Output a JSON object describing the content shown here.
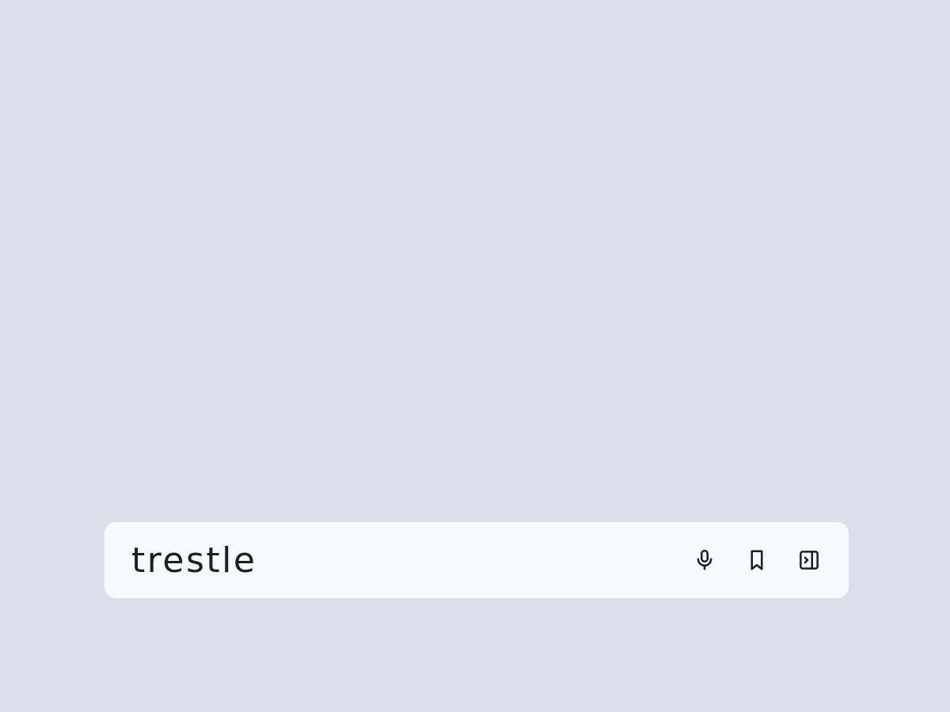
{
  "search": {
    "query": "trestle"
  },
  "toolbar": {
    "icons": [
      "microphone-icon",
      "bookmark-icon",
      "sidebar-panel-icon"
    ]
  },
  "colors": {
    "background": "#dcdfe7",
    "bar": "#f6f8fb",
    "text": "#1c1f27"
  }
}
